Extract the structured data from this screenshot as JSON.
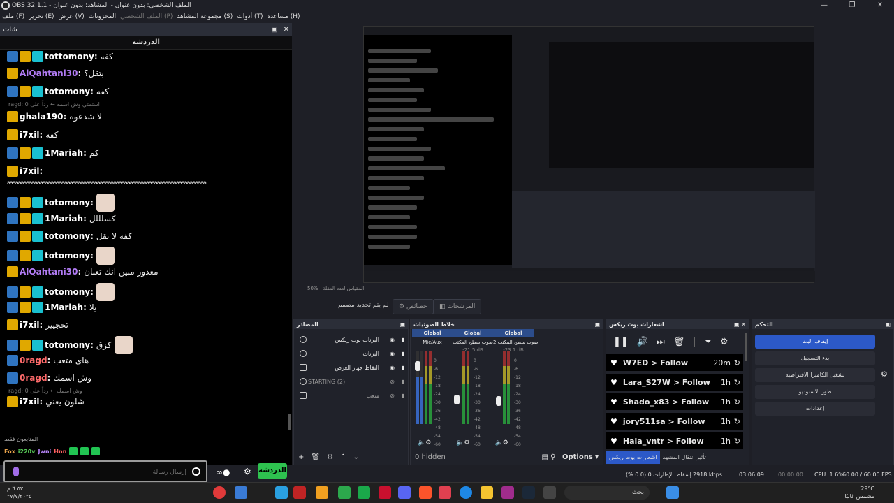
{
  "window": {
    "title": "OBS 32.1.1 - الملف الشخصي: بدون عنوان - المشاهد: بدون عنوان",
    "controls": [
      "—",
      "❐",
      "✕"
    ]
  },
  "menu": [
    "ملف (F)",
    "تحرير (E)",
    "عرض (V)",
    "المخزونات",
    "الملف الشخصي (P)",
    "مجموعة المشاهد (S)",
    "أدوات (T)",
    "مساعدة (H)"
  ],
  "chat": {
    "dock_title": "شات",
    "header": "الدردشة",
    "messages": [
      {
        "user": "tottomony",
        "text": "كفه",
        "color": "#ffffff"
      },
      {
        "user": "AlQahtani30",
        "text": "بتقل؟",
        "color": "#b27cf5"
      },
      {
        "user": "totomony",
        "text": "كفه",
        "color": "#ffffff"
      },
      {
        "user": "ghala190",
        "text": "لا شدعوه",
        "color": "#ffffff"
      },
      {
        "user": "i7xil",
        "text": "كفه",
        "color": "#ffffff"
      },
      {
        "user": "1Mariah",
        "text": "كم",
        "color": "#ffffff"
      },
      {
        "user": "i7xil",
        "text": "",
        "color": "#ffffff"
      },
      {
        "user": "totomony",
        "text": "",
        "color": "#ffffff"
      },
      {
        "user": "1Mariah",
        "text": "كسلللل",
        "color": "#ffffff"
      },
      {
        "user": "totomony",
        "text": "كفه لا تقل",
        "color": "#ffffff"
      },
      {
        "user": "totomony",
        "text": "",
        "color": "#ffffff"
      },
      {
        "user": "AlQahtani30",
        "text": "معذور مبين انك تعبان",
        "color": "#b27cf5"
      },
      {
        "user": "totomony",
        "text": "",
        "color": "#ffffff"
      },
      {
        "user": "1Mariah",
        "text": "يلا",
        "color": "#ffffff"
      },
      {
        "user": "i7xil",
        "text": "تحجيير",
        "color": "#ffffff"
      },
      {
        "user": "totomony",
        "text": "كزق",
        "color": "#ffffff"
      },
      {
        "user": "0ragd",
        "text": "هاي متعب",
        "color": "#ff6b6b"
      },
      {
        "user": "0ragd",
        "text": "وش اسمك",
        "color": "#ff6b6b"
      },
      {
        "user": "i7xil",
        "text": "شلون يعني",
        "color": "#ffffff"
      }
    ],
    "long_line": "aaaaaaaaaaaaaaaaaaaaaaaaaaaaaaaaaaaaaaaaaaaaaaaaaaaaaaaaaaaaaaaaaaaaaaaaa",
    "reply1": "ragd: استمتي وش اسمه  ← رداً على 0",
    "reply2": "ragd: وش اسمك ← رداً على 0",
    "followers_only": "المتابعون فقط",
    "emote_words": [
      "Fox",
      "i220v",
      "Jwni",
      "Hnn"
    ],
    "input_placeholder": "إرسال رسالة",
    "send_label": "الدردشة"
  },
  "preview": {
    "zoom_label": "50%",
    "stream_time_hint": "المقياس لعدد المقلة"
  },
  "mode_row": {
    "studio_text": "لم يتم تحديد مصمم",
    "properties": "خصائص",
    "filters": "المرشحات"
  },
  "sources": {
    "title": "المصادر",
    "items": [
      {
        "label": "البرنات بوت ريكس"
      },
      {
        "label": "البرنات"
      },
      {
        "label": "التقاط جهاز العرض"
      },
      {
        "label": "STARTING (2)"
      },
      {
        "label": "متعب"
      }
    ]
  },
  "mixer": {
    "title": "خلاط الصوتيات",
    "channels": [
      {
        "global": "Global",
        "name": "Mic/Aux",
        "db": ""
      },
      {
        "global": "Global",
        "name": "صوت سطح المكتب",
        "db": "-21.5 dB"
      },
      {
        "global": "Global",
        "name": "صوت سطح المكتب 2",
        "db": "-23.1 dB"
      }
    ],
    "scale": [
      "0",
      "-6",
      "-12",
      "-18",
      "-24",
      "-30",
      "-36",
      "-42",
      "-48",
      "-54",
      "-60"
    ],
    "hidden": "0 hidden",
    "options": "Options"
  },
  "bot": {
    "title": "اشعارات بوت ريكس",
    "follows": [
      {
        "name": "W7ED > Follow",
        "time": "20m"
      },
      {
        "name": "Lara_S27W > Follow",
        "time": "1h"
      },
      {
        "name": "Shado_x83 > Follow",
        "time": "1h"
      },
      {
        "name": "jory511sa > Follow",
        "time": "1h"
      },
      {
        "name": "Hala_vntr > Follow",
        "time": "1h"
      }
    ],
    "tab_active": "اشعارات بوت ريكس",
    "tab_other": "تأثير انتقال المشهد"
  },
  "controls": {
    "title": "التحكم",
    "buttons": [
      "إيقاف البث",
      "بدء التسجيل",
      "تشغيل الكاميرا الافتراضية",
      "طور الاستوديو",
      "إعدادات"
    ]
  },
  "status": {
    "dropped": "إسقاط الإطارات 0 (0.0 %)",
    "kbps": "2918 kbps",
    "live_time": "03:06:09",
    "rec_time": "00:00:00",
    "cpu": "CPU: 1.6%",
    "fps": "60.00 / 60.00 FPS"
  },
  "taskbar": {
    "clock_time": "٦:٥٣ م",
    "clock_date": "٢٧/٧/٢٠٢٥",
    "search": "بحث",
    "temp": "29°C",
    "weather": "مشمس غالبًا"
  },
  "colors": {
    "accent": "#2c59c8",
    "chat_send": "#2ec24f"
  }
}
